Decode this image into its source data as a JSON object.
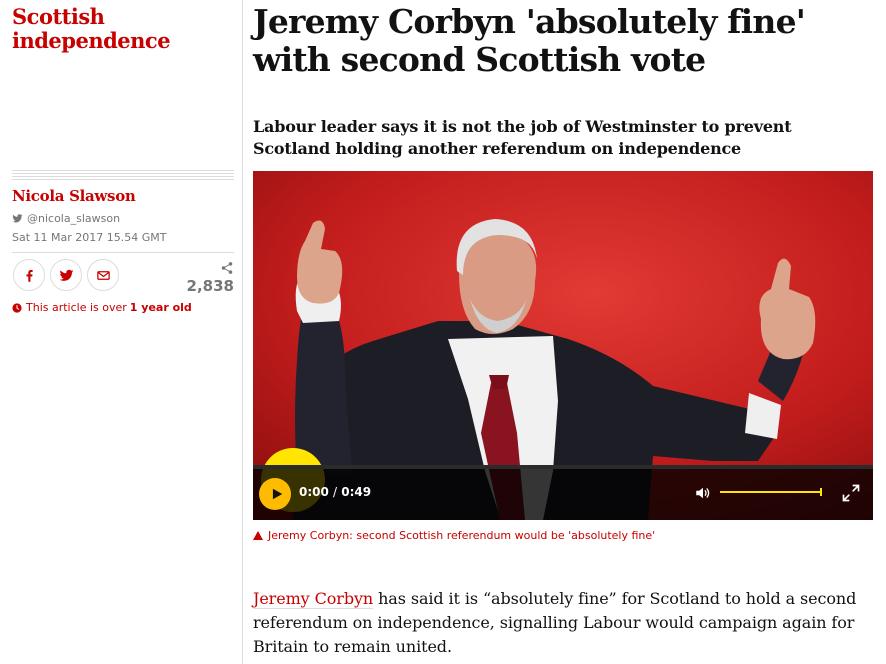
{
  "section": {
    "label": "Scottish independence"
  },
  "byline": {
    "author": "Nicola Slawson",
    "twitter_handle": "@nicola_slawson",
    "published": "Sat 11 Mar 2017 15.54 GMT"
  },
  "share": {
    "count": "2,838",
    "buttons": [
      "facebook-icon",
      "twitter-icon",
      "email-icon"
    ]
  },
  "age_warning": {
    "prefix": "This article is over",
    "age": "1 year old"
  },
  "article": {
    "headline": "Jeremy Corbyn 'absolutely fine' with second Scottish vote",
    "standfirst": "Labour leader says it is not the job of Westminster to prevent Scotland holding another referendum on independence",
    "caption": "Jeremy Corbyn: second Scottish referendum would be 'absolutely fine'",
    "body_link": "Jeremy Corbyn",
    "body_rest": " has said it is “absolutely fine” for Scotland to hold a second referendum on independence, signalling Labour would campaign again for Britain to remain united."
  },
  "video": {
    "current_time": "0:00",
    "separator": "/",
    "duration": "0:49",
    "volume_level": 1.0
  },
  "colors": {
    "accent": "#c70000",
    "play_button": "#ffbb00",
    "volume": "#ffe500",
    "text": "#121212",
    "muted": "#767676"
  }
}
